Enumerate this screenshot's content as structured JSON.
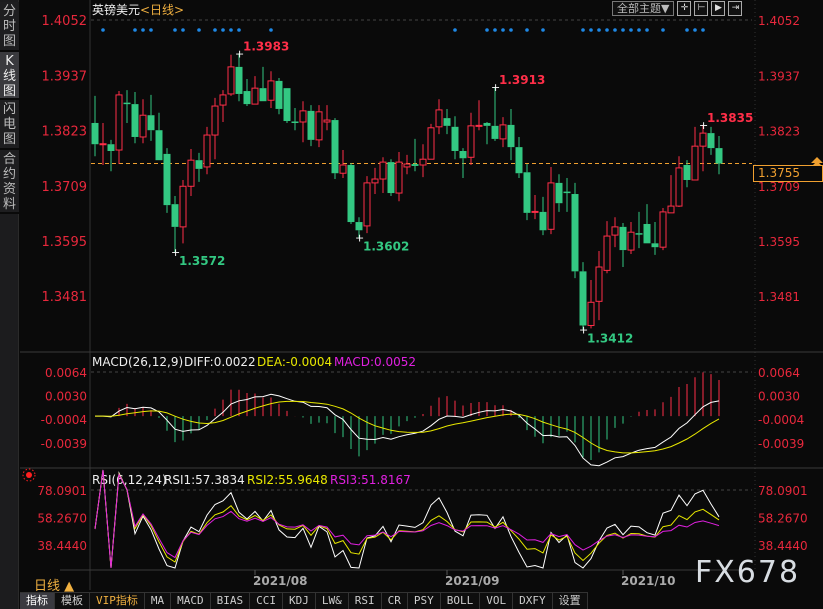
{
  "sidebar": {
    "items": [
      {
        "label": "分时图"
      },
      {
        "label": "K线图"
      },
      {
        "label": "闪电图"
      },
      {
        "label": "合约资料"
      }
    ]
  },
  "header": {
    "symbol": "英镑美元",
    "period": "<日线>",
    "theme_button": "全部主题▼",
    "tools": [
      "crosshair-icon",
      "zoom-range-icon",
      "play-forward-icon",
      "move-right-icon"
    ]
  },
  "colors": {
    "up": "#ff2e48",
    "down": "#33c882",
    "axis_text": "#e8283c",
    "dif": "#ffffff",
    "dea": "#e8e800",
    "macd": "#e020e0",
    "current": "#f0a030",
    "event_dot": "#1e88e5"
  },
  "current_price": "1.3755",
  "chart_data": {
    "type": "candlestick",
    "title": "英镑美元 <日线>",
    "price_axis": {
      "ticks": [
        "1.4052",
        "1.3937",
        "1.3823",
        "1.3709",
        "1.3595",
        "1.3481"
      ],
      "ylim": [
        1.3481,
        1.4052
      ]
    },
    "x_ticks": [
      {
        "label": "2021/08",
        "index": 20
      },
      {
        "label": "2021/09",
        "index": 44
      },
      {
        "label": "2021/10",
        "index": 66
      }
    ],
    "ohlc": [
      [
        1.3839,
        1.3895,
        1.377,
        1.3795
      ],
      [
        1.3795,
        1.3839,
        1.3752,
        1.3796
      ],
      [
        1.3795,
        1.3804,
        1.3739,
        1.3781
      ],
      [
        1.3783,
        1.3905,
        1.3754,
        1.3897
      ],
      [
        1.3881,
        1.3907,
        1.3839,
        1.388
      ],
      [
        1.3878,
        1.3903,
        1.3797,
        1.381
      ],
      [
        1.381,
        1.3888,
        1.3797,
        1.3855
      ],
      [
        1.3855,
        1.3897,
        1.3802,
        1.3824
      ],
      [
        1.3824,
        1.386,
        1.3762,
        1.3762
      ],
      [
        1.3775,
        1.3787,
        1.3653,
        1.3669
      ],
      [
        1.3671,
        1.3688,
        1.3572,
        1.3624
      ],
      [
        1.3624,
        1.3721,
        1.359,
        1.3708
      ],
      [
        1.3708,
        1.3785,
        1.3688,
        1.3762
      ],
      [
        1.3762,
        1.3777,
        1.3717,
        1.3744
      ],
      [
        1.3748,
        1.3831,
        1.3733,
        1.3814
      ],
      [
        1.3814,
        1.3891,
        1.3764,
        1.3874
      ],
      [
        1.3876,
        1.3907,
        1.3841,
        1.3897
      ],
      [
        1.3899,
        1.398,
        1.3895,
        1.3955
      ],
      [
        1.3955,
        1.3983,
        1.3884,
        1.3899
      ],
      [
        1.3905,
        1.393,
        1.3874,
        1.3878
      ],
      [
        1.3878,
        1.3936,
        1.3878,
        1.3911
      ],
      [
        1.3911,
        1.3955,
        1.3884,
        1.3884
      ],
      [
        1.3886,
        1.3946,
        1.387,
        1.3926
      ],
      [
        1.3926,
        1.3932,
        1.3857,
        1.3868
      ],
      [
        1.3911,
        1.3911,
        1.3839,
        1.3843
      ],
      [
        1.3842,
        1.387,
        1.3824,
        1.3841
      ],
      [
        1.3841,
        1.3884,
        1.3799,
        1.3864
      ],
      [
        1.3864,
        1.3876,
        1.3791,
        1.3804
      ],
      [
        1.3804,
        1.3876,
        1.3789,
        1.3862
      ],
      [
        1.3841,
        1.3876,
        1.3824,
        1.3845
      ],
      [
        1.3845,
        1.3849,
        1.3723,
        1.3735
      ],
      [
        1.3735,
        1.3783,
        1.3725,
        1.3752
      ],
      [
        1.3752,
        1.3756,
        1.363,
        1.3634
      ],
      [
        1.3634,
        1.3644,
        1.3602,
        1.3617
      ],
      [
        1.3626,
        1.3729,
        1.3611,
        1.3715
      ],
      [
        1.3715,
        1.3746,
        1.3692,
        1.3723
      ],
      [
        1.3723,
        1.3768,
        1.3694,
        1.3758
      ],
      [
        1.3758,
        1.3764,
        1.3688,
        1.3694
      ],
      [
        1.3694,
        1.3779,
        1.3677,
        1.3758
      ],
      [
        1.3748,
        1.3773,
        1.3733,
        1.3754
      ],
      [
        1.3754,
        1.3806,
        1.3739,
        1.375
      ],
      [
        1.3752,
        1.3795,
        1.3727,
        1.3764
      ],
      [
        1.3764,
        1.3837,
        1.3764,
        1.3829
      ],
      [
        1.3831,
        1.3888,
        1.3816,
        1.3866
      ],
      [
        1.3849,
        1.3868,
        1.3816,
        1.3833
      ],
      [
        1.3831,
        1.3853,
        1.3764,
        1.3781
      ],
      [
        1.3781,
        1.3787,
        1.3725,
        1.3766
      ],
      [
        1.3768,
        1.386,
        1.3752,
        1.3833
      ],
      [
        1.3833,
        1.3886,
        1.3824,
        1.3834
      ],
      [
        1.3839,
        1.3841,
        1.3795,
        1.3833
      ],
      [
        1.3833,
        1.3913,
        1.3802,
        1.3806
      ],
      [
        1.3806,
        1.3851,
        1.3789,
        1.3835
      ],
      [
        1.3835,
        1.3868,
        1.3762,
        1.3789
      ],
      [
        1.3789,
        1.381,
        1.3725,
        1.3735
      ],
      [
        1.3737,
        1.3754,
        1.3638,
        1.3653
      ],
      [
        1.3655,
        1.369,
        1.364,
        1.3656
      ],
      [
        1.3655,
        1.3686,
        1.3607,
        1.3617
      ],
      [
        1.3619,
        1.3748,
        1.3609,
        1.3715
      ],
      [
        1.3715,
        1.3733,
        1.3655,
        1.3673
      ],
      [
        1.3697,
        1.3725,
        1.3655,
        1.3696
      ],
      [
        1.3692,
        1.3715,
        1.3518,
        1.3532
      ],
      [
        1.3532,
        1.3551,
        1.3412,
        1.342
      ],
      [
        1.342,
        1.3514,
        1.3414,
        1.3468
      ],
      [
        1.347,
        1.3574,
        1.3431,
        1.3541
      ],
      [
        1.3534,
        1.3636,
        1.3528,
        1.3605
      ],
      [
        1.3607,
        1.3644,
        1.3582,
        1.3624
      ],
      [
        1.3624,
        1.3632,
        1.3541,
        1.3576
      ],
      [
        1.3576,
        1.3634,
        1.3568,
        1.3613
      ],
      [
        1.3611,
        1.3655,
        1.358,
        1.361
      ],
      [
        1.363,
        1.3671,
        1.359,
        1.359
      ],
      [
        1.359,
        1.3634,
        1.3566,
        1.3582
      ],
      [
        1.3582,
        1.3663,
        1.3576,
        1.3655
      ],
      [
        1.3653,
        1.3731,
        1.3653,
        1.3667
      ],
      [
        1.3667,
        1.377,
        1.3665,
        1.3746
      ],
      [
        1.3752,
        1.3762,
        1.3706,
        1.3721
      ],
      [
        1.3721,
        1.3831,
        1.3721,
        1.3791
      ],
      [
        1.3791,
        1.3835,
        1.3739,
        1.3818
      ],
      [
        1.3818,
        1.3831,
        1.3773,
        1.3787
      ],
      [
        1.3787,
        1.3812,
        1.3733,
        1.3755
      ]
    ],
    "annotations": [
      {
        "index": 18,
        "type": "high",
        "label": "1.3983"
      },
      {
        "index": 10,
        "type": "low",
        "label": "1.3572"
      },
      {
        "index": 33,
        "type": "low",
        "label": "1.3602"
      },
      {
        "index": 50,
        "type": "high",
        "label": "1.3913"
      },
      {
        "index": 61,
        "type": "low",
        "label": "1.3412"
      },
      {
        "index": 76,
        "type": "high",
        "label": "1.3835"
      }
    ],
    "event_dots": [
      1,
      5,
      6,
      7,
      10,
      11,
      13,
      15,
      16,
      17,
      18,
      22,
      45,
      49,
      50,
      51,
      52,
      54,
      56,
      61,
      62,
      63,
      64,
      65,
      66,
      67,
      68,
      69,
      71,
      74,
      75,
      76
    ],
    "macd": {
      "title": "MACD(26,12,9)",
      "diff_label": "DIFF:0.0022",
      "dea_label": "DEA:-0.0004",
      "macd_label": "MACD:0.0052",
      "ticks": [
        "0.0064",
        "0.0030",
        "-0.0004",
        "-0.0039"
      ],
      "tick_values": [
        0.0064,
        0.003,
        -0.0004,
        -0.0039
      ]
    },
    "rsi": {
      "title": "RSI(6,12,24)",
      "rsi1_label": "RSI1:57.3834",
      "rsi2_label": "RSI2:55.9648",
      "rsi3_label": "RSI3:51.8167",
      "ticks": [
        "78.0901",
        "58.2670",
        "38.4440"
      ],
      "tick_values": [
        78.0901,
        58.267,
        38.444
      ]
    }
  },
  "footer": {
    "period": "日线 ▲",
    "tabs": [
      "指标",
      "模板",
      "VIP指标",
      "MA",
      "MACD",
      "BIAS",
      "CCI",
      "KDJ",
      "LW&",
      "RSI",
      "CR",
      "PSY",
      "BOLL",
      "VOL",
      "DXFY",
      "设置"
    ],
    "watermark": "FX678"
  }
}
